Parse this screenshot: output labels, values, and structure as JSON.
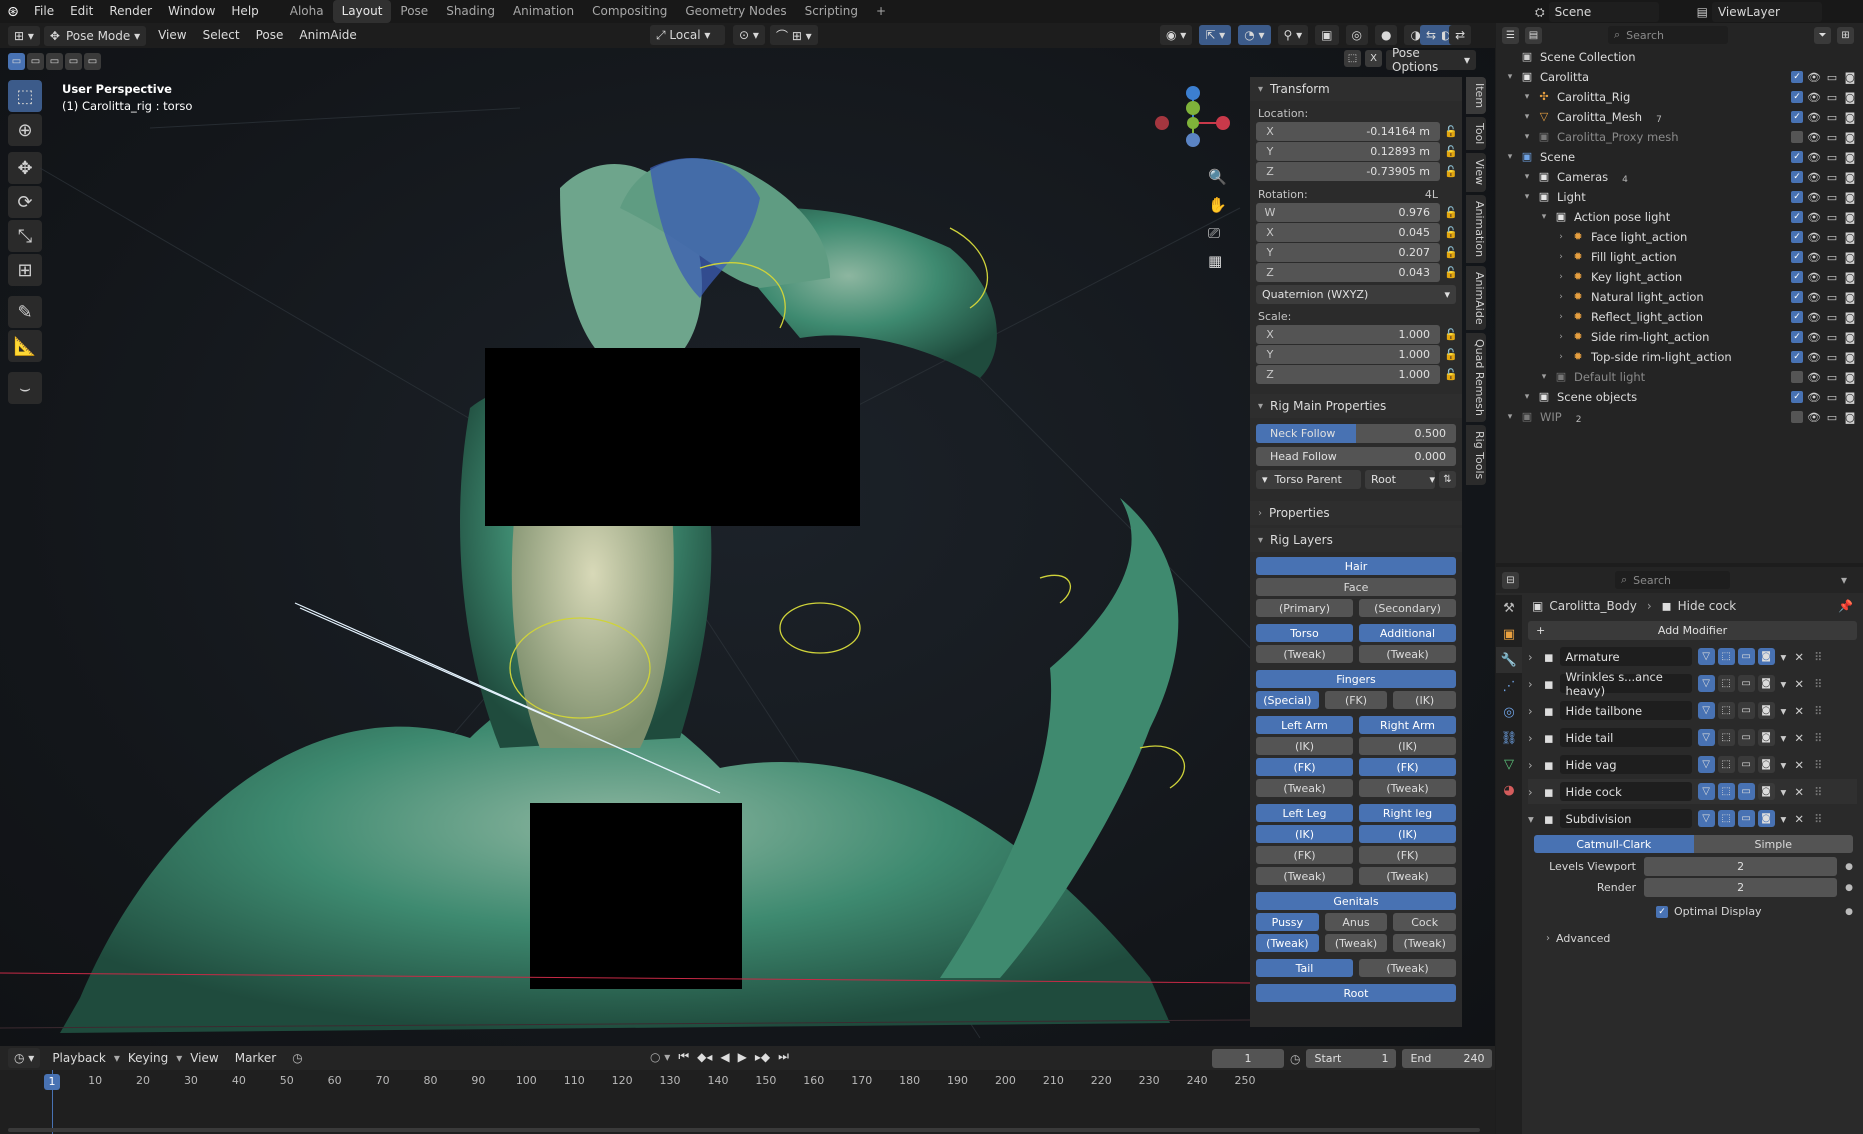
{
  "menubar": {
    "items": [
      "File",
      "Edit",
      "Render",
      "Window",
      "Help"
    ]
  },
  "workspaces": {
    "tabs": [
      "Aloha",
      "Layout",
      "Pose",
      "Shading",
      "Animation",
      "Compositing",
      "Geometry Nodes",
      "Scripting"
    ],
    "active": "Layout"
  },
  "scene_name": "Scene",
  "view_layer": "ViewLayer",
  "vp_header": {
    "mode": "Pose Mode",
    "menus": [
      "View",
      "Select",
      "Pose",
      "AnimAide"
    ],
    "orientation": "Local",
    "pose_options": "Pose Options"
  },
  "viewport": {
    "view_name": "User Perspective",
    "object_info": "(1) Carolitta_rig : torso"
  },
  "npanel": {
    "transform": {
      "title": "Transform",
      "location_label": "Location:",
      "location": [
        {
          "k": "X",
          "v": "-0.14164 m"
        },
        {
          "k": "Y",
          "v": "0.12893 m"
        },
        {
          "k": "Z",
          "v": "-0.73905 m"
        }
      ],
      "rotation_label": "Rotation:",
      "rotation_mode_flag": "4L",
      "rotation": [
        {
          "k": "W",
          "v": "0.976"
        },
        {
          "k": "X",
          "v": "0.045"
        },
        {
          "k": "Y",
          "v": "0.207"
        },
        {
          "k": "Z",
          "v": "0.043"
        }
      ],
      "rotation_mode": "Quaternion (WXYZ)",
      "scale_label": "Scale:",
      "scale": [
        {
          "k": "X",
          "v": "1.000"
        },
        {
          "k": "Y",
          "v": "1.000"
        },
        {
          "k": "Z",
          "v": "1.000"
        }
      ]
    },
    "rig_main": {
      "title": "Rig Main Properties",
      "neck_follow_label": "Neck Follow",
      "neck_follow": "0.500",
      "head_follow_label": "Head Follow",
      "head_follow": "0.000",
      "torso_parent_label": "Torso Parent",
      "torso_parent": "Root"
    },
    "properties_title": "Properties",
    "rig_layers": {
      "title": "Rig Layers",
      "hair": "Hair",
      "face": "Face",
      "primary": "(Primary)",
      "secondary": "(Secondary)",
      "torso": "Torso",
      "additional": "Additional",
      "tweak": "(Tweak)",
      "fingers": "Fingers",
      "special": "(Special)",
      "fk": "(FK)",
      "ik": "(IK)",
      "left_arm": "Left Arm",
      "right_arm": "Right Arm",
      "left_leg": "Left Leg",
      "right_leg": "Right leg",
      "genitals": "Genitals",
      "pussy": "Pussy",
      "anus": "Anus",
      "cock": "Cock",
      "tail": "Tail",
      "root": "Root"
    }
  },
  "vtabs": [
    "Item",
    "Tool",
    "View",
    "Animation",
    "AnimAide",
    "Quad Remesh",
    "Rig Tools"
  ],
  "outliner": {
    "search_placeholder": "Search",
    "scene_collection": "Scene Collection",
    "rows": [
      {
        "label": "Carolitta",
        "indent": 0,
        "icon": "collection"
      },
      {
        "label": "Carolitta_Rig",
        "indent": 1,
        "icon": "armature"
      },
      {
        "label": "Carolitta_Mesh",
        "indent": 1,
        "icon": "mesh",
        "badge": "7"
      },
      {
        "label": "Carolitta_Proxy mesh",
        "indent": 1,
        "icon": "collection-dim"
      },
      {
        "label": "Scene",
        "indent": 0,
        "icon": "collection-blue"
      },
      {
        "label": "Cameras",
        "indent": 1,
        "icon": "collection",
        "badge": "4"
      },
      {
        "label": "Light",
        "indent": 1,
        "icon": "collection"
      },
      {
        "label": "Action pose light",
        "indent": 2,
        "icon": "collection"
      },
      {
        "label": "Face light_action",
        "indent": 3,
        "icon": "light"
      },
      {
        "label": "Fill light_action",
        "indent": 3,
        "icon": "light"
      },
      {
        "label": "Key light_action",
        "indent": 3,
        "icon": "light"
      },
      {
        "label": "Natural light_action",
        "indent": 3,
        "icon": "light"
      },
      {
        "label": "Reflect_light_action",
        "indent": 3,
        "icon": "light"
      },
      {
        "label": "Side rim-light_action",
        "indent": 3,
        "icon": "light"
      },
      {
        "label": "Top-side rim-light_action",
        "indent": 3,
        "icon": "light"
      },
      {
        "label": "Default light",
        "indent": 2,
        "icon": "collection-dim"
      },
      {
        "label": "Scene objects",
        "indent": 1,
        "icon": "collection"
      },
      {
        "label": "WIP",
        "indent": 0,
        "icon": "collection-dim",
        "badge": "2"
      }
    ]
  },
  "properties": {
    "search_placeholder": "Search",
    "breadcrumb_object": "Carolitta_Body",
    "breadcrumb_modifier": "Hide cock",
    "add_modifier": "Add Modifier",
    "modifiers": [
      "Armature",
      "Wrinkles s...ance heavy)",
      "Hide tailbone",
      "Hide tail",
      "Hide vag",
      "Hide cock",
      "Subdivision"
    ],
    "subdivision": {
      "catmull": "Catmull-Clark",
      "simple": "Simple",
      "levels_viewport_label": "Levels Viewport",
      "levels_viewport": "2",
      "render_label": "Render",
      "render": "2",
      "optimal_display": "Optimal Display",
      "advanced": "Advanced"
    }
  },
  "timeline": {
    "menus": [
      "Playback",
      "Keying",
      "View",
      "Marker"
    ],
    "current_frame": "1",
    "start_label": "Start",
    "start": "1",
    "end_label": "End",
    "end": "240",
    "ticks": [
      "1",
      "10",
      "20",
      "30",
      "40",
      "50",
      "60",
      "70",
      "80",
      "90",
      "100",
      "110",
      "120",
      "130",
      "140",
      "150",
      "160",
      "170",
      "180",
      "190",
      "200",
      "210",
      "220",
      "230",
      "240",
      "250"
    ]
  }
}
